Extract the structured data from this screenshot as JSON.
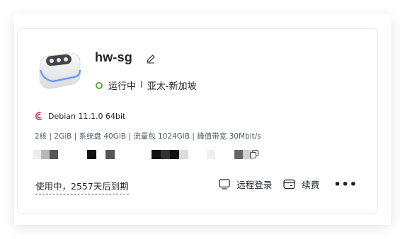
{
  "instance": {
    "name": "hw-sg",
    "status": "运行中",
    "region": "亚太-新加坡",
    "status_color": "#4caf2f",
    "os": "Debian 11.1.0 64bit",
    "specs": "2核 | 2GiB | 系统盘 40GiB | 流量包 1024GiB | 峰值带宽 30Mbit/s",
    "expiry": "使用中，2557天后到期"
  },
  "actions": {
    "remote_login": "远程登录",
    "renew": "续费",
    "more": "•••"
  },
  "icons": {
    "device": "server-device-icon",
    "edit": "pencil-icon",
    "os": "debian-logo-icon",
    "copy": "copy-icon",
    "remote": "monitor-icon",
    "renew": "wallet-icon"
  }
}
